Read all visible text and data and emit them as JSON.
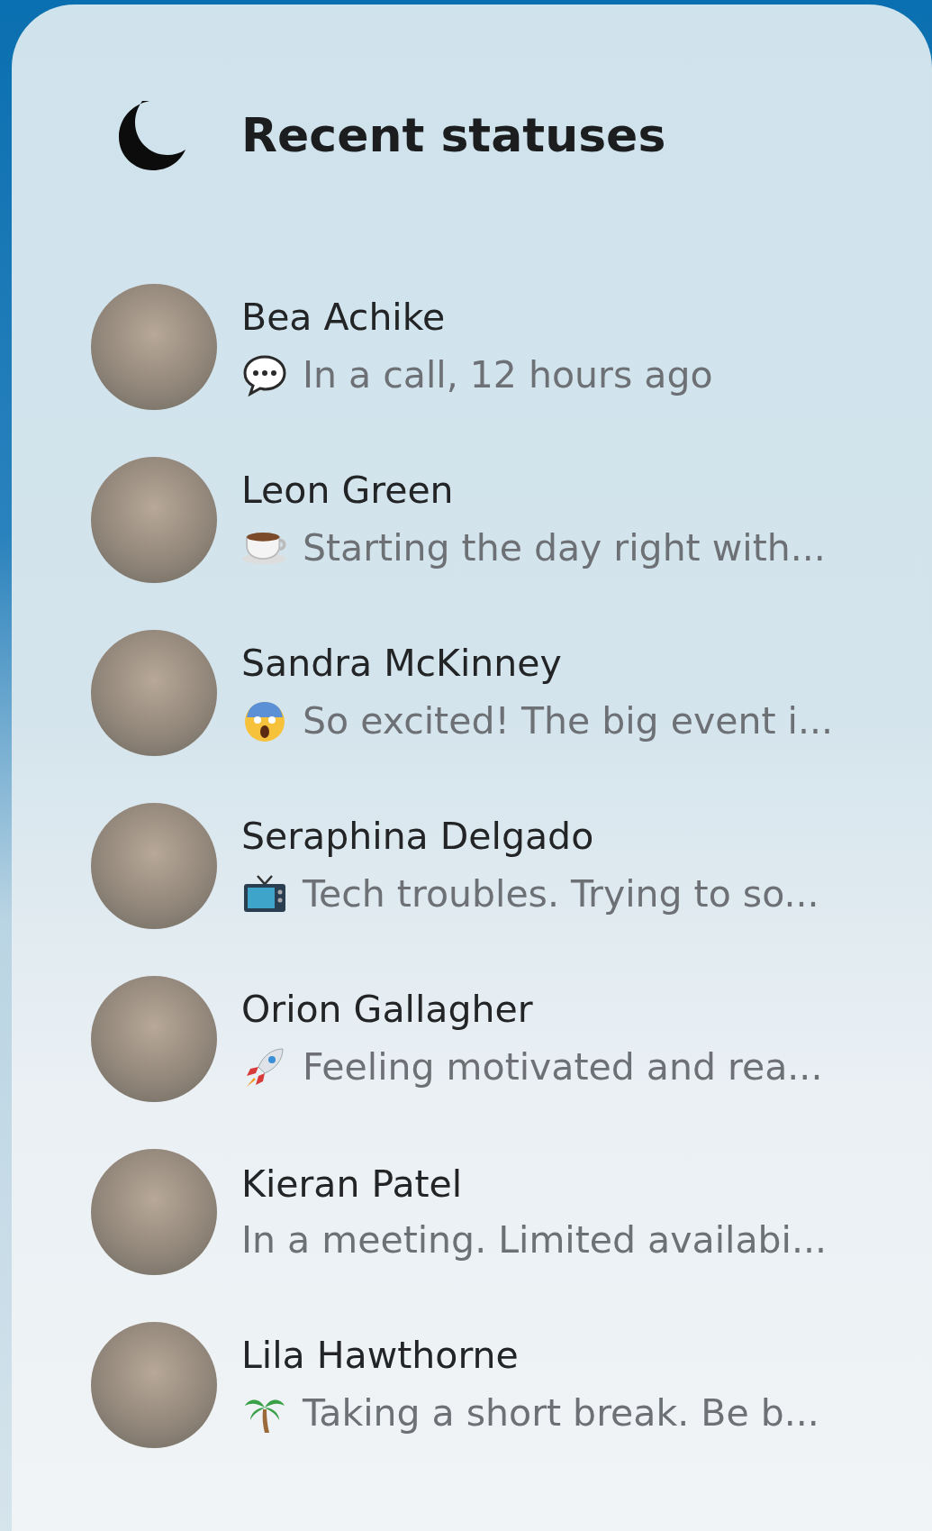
{
  "title": "Recent statuses",
  "people": [
    {
      "name": "Bea Achike",
      "status": "In a call, 12 hours ago",
      "kind": "bubble"
    },
    {
      "name": "Leon Green",
      "status": "Starting the day right with...",
      "kind": "cup"
    },
    {
      "name": "Sandra McKinney",
      "status": "So excited! The big event i...",
      "kind": "shock"
    },
    {
      "name": "Seraphina Delgado",
      "status": "Tech troubles. Trying to so...",
      "kind": "tv"
    },
    {
      "name": "Orion Gallagher",
      "status": "Feeling motivated and rea...",
      "kind": "rocket"
    },
    {
      "name": "Kieran Patel",
      "status": "In a meeting. Limited availabi...",
      "kind": "none"
    },
    {
      "name": "Lila Hawthorne",
      "status": "Taking a short break. Be b...",
      "kind": "palm"
    }
  ]
}
